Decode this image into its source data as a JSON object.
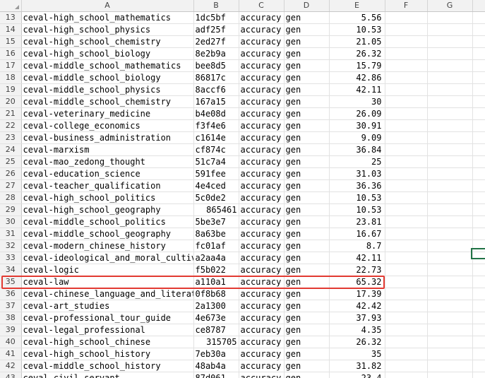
{
  "columns": [
    "A",
    "B",
    "C",
    "D",
    "E",
    "F",
    "G",
    ""
  ],
  "highlighted_row": "35",
  "colors": {
    "highlight_border": "#e23a32",
    "active_cell_border": "#217346",
    "header_bg": "#f2f2f2"
  },
  "rows": [
    {
      "rn": "13",
      "a": "ceval-high_school_mathematics",
      "b": "1dc5bf",
      "c": "accuracy",
      "d": "gen",
      "e": "5.56"
    },
    {
      "rn": "14",
      "a": "ceval-high_school_physics",
      "b": "adf25f",
      "c": "accuracy",
      "d": "gen",
      "e": "10.53"
    },
    {
      "rn": "15",
      "a": "ceval-high_school_chemistry",
      "b": "2ed27f",
      "c": "accuracy",
      "d": "gen",
      "e": "21.05"
    },
    {
      "rn": "16",
      "a": "ceval-high_school_biology",
      "b": "8e2b9a",
      "c": "accuracy",
      "d": "gen",
      "e": "26.32"
    },
    {
      "rn": "17",
      "a": "ceval-middle_school_mathematics",
      "b": "bee8d5",
      "c": "accuracy",
      "d": "gen",
      "e": "15.79"
    },
    {
      "rn": "18",
      "a": "ceval-middle_school_biology",
      "b": "86817c",
      "c": "accuracy",
      "d": "gen",
      "e": "42.86"
    },
    {
      "rn": "19",
      "a": "ceval-middle_school_physics",
      "b": "8accf6",
      "c": "accuracy",
      "d": "gen",
      "e": "42.11"
    },
    {
      "rn": "20",
      "a": "ceval-middle_school_chemistry",
      "b": "167a15",
      "c": "accuracy",
      "d": "gen",
      "e": "30"
    },
    {
      "rn": "21",
      "a": "ceval-veterinary_medicine",
      "b": "b4e08d",
      "c": "accuracy",
      "d": "gen",
      "e": "26.09"
    },
    {
      "rn": "22",
      "a": "ceval-college_economics",
      "b": "f3f4e6",
      "c": "accuracy",
      "d": "gen",
      "e": "30.91"
    },
    {
      "rn": "23",
      "a": "ceval-business_administration",
      "b": "c1614e",
      "c": "accuracy",
      "d": "gen",
      "e": "9.09"
    },
    {
      "rn": "24",
      "a": "ceval-marxism",
      "b": "cf874c",
      "c": "accuracy",
      "d": "gen",
      "e": "36.84"
    },
    {
      "rn": "25",
      "a": "ceval-mao_zedong_thought",
      "b": "51c7a4",
      "c": "accuracy",
      "d": "gen",
      "e": "25"
    },
    {
      "rn": "26",
      "a": "ceval-education_science",
      "b": "591fee",
      "c": "accuracy",
      "d": "gen",
      "e": "31.03"
    },
    {
      "rn": "27",
      "a": "ceval-teacher_qualification",
      "b": "4e4ced",
      "c": "accuracy",
      "d": "gen",
      "e": "36.36"
    },
    {
      "rn": "28",
      "a": "ceval-high_school_politics",
      "b": "5c0de2",
      "c": "accuracy",
      "d": "gen",
      "e": "10.53"
    },
    {
      "rn": "29",
      "a": "ceval-high_school_geography",
      "b": "865461",
      "c": "accuracy",
      "d": "gen",
      "e": "10.53",
      "b_overflow": true
    },
    {
      "rn": "30",
      "a": "ceval-middle_school_politics",
      "b": "5be3e7",
      "c": "accuracy",
      "d": "gen",
      "e": "23.81"
    },
    {
      "rn": "31",
      "a": "ceval-middle_school_geography",
      "b": "8a63be",
      "c": "accuracy",
      "d": "gen",
      "e": "16.67"
    },
    {
      "rn": "32",
      "a": "ceval-modern_chinese_history",
      "b": "fc01af",
      "c": "accuracy",
      "d": "gen",
      "e": "8.7"
    },
    {
      "rn": "33",
      "a": "ceval-ideological_and_moral_cultivati",
      "b": "a2aa4a",
      "c": "accuracy",
      "d": "gen",
      "e": "42.11"
    },
    {
      "rn": "34",
      "a": "ceval-logic",
      "b": "f5b022",
      "c": "accuracy",
      "d": "gen",
      "e": "22.73"
    },
    {
      "rn": "35",
      "a": "ceval-law",
      "b": "a110a1",
      "c": "accuracy",
      "d": "gen",
      "e": "65.32"
    },
    {
      "rn": "36",
      "a": "ceval-chinese_language_and_literature",
      "b": "0f8b68",
      "c": "accuracy",
      "d": "gen",
      "e": "17.39"
    },
    {
      "rn": "37",
      "a": "ceval-art_studies",
      "b": "2a1300",
      "c": "accuracy",
      "d": "gen",
      "e": "42.42"
    },
    {
      "rn": "38",
      "a": "ceval-professional_tour_guide",
      "b": "4e673e",
      "c": "accuracy",
      "d": "gen",
      "e": "37.93"
    },
    {
      "rn": "39",
      "a": "ceval-legal_professional",
      "b": "ce8787",
      "c": "accuracy",
      "d": "gen",
      "e": "4.35"
    },
    {
      "rn": "40",
      "a": "ceval-high_school_chinese",
      "b": "315705",
      "c": "accuracy",
      "d": "gen",
      "e": "26.32",
      "b_overflow": true
    },
    {
      "rn": "41",
      "a": "ceval-high_school_history",
      "b": "7eb30a",
      "c": "accuracy",
      "d": "gen",
      "e": "35"
    },
    {
      "rn": "42",
      "a": "ceval-middle_school_history",
      "b": "48ab4a",
      "c": "accuracy",
      "d": "gen",
      "e": "31.82"
    },
    {
      "rn": "43",
      "a": "ceval-civil_servant",
      "b": "87d061",
      "c": "accuracy",
      "d": "gen",
      "e": "23.4"
    }
  ]
}
